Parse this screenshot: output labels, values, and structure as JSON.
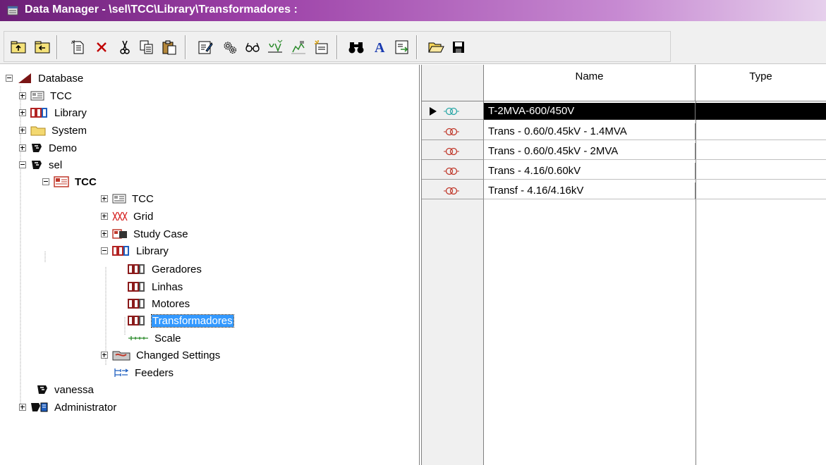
{
  "window": {
    "title": "Data Manager - \\sel\\TCC\\Library\\Transformadores :"
  },
  "toolbar": {
    "buttons": [
      {
        "icon": "folder-up-icon"
      },
      {
        "icon": "folder-back-icon"
      },
      {
        "icon": "new-object-icon"
      },
      {
        "icon": "delete-icon"
      },
      {
        "icon": "cut-icon"
      },
      {
        "icon": "copy-icon"
      },
      {
        "icon": "paste-icon"
      },
      {
        "icon": "edit-object-icon"
      },
      {
        "icon": "settings-gears-icon"
      },
      {
        "icon": "glasses-view-icon"
      },
      {
        "icon": "filter-icon"
      },
      {
        "icon": "graphic-filter-icon"
      },
      {
        "icon": "new-folder-icon"
      },
      {
        "icon": "binoculars-find-icon"
      },
      {
        "icon": "font-icon"
      },
      {
        "icon": "export-icon"
      },
      {
        "icon": "open-icon"
      },
      {
        "icon": "save-icon"
      }
    ]
  },
  "tree": {
    "root": "Database",
    "items": [
      {
        "label": "TCC"
      },
      {
        "label": "Library"
      },
      {
        "label": "System"
      },
      {
        "label": "Demo"
      },
      {
        "label": "sel"
      },
      {
        "label": "TCC"
      },
      {
        "label": "TCC"
      },
      {
        "label": "Grid"
      },
      {
        "label": "Study Case"
      },
      {
        "label": "Library"
      },
      {
        "label": "Geradores"
      },
      {
        "label": "Linhas"
      },
      {
        "label": "Motores"
      },
      {
        "label": "Transformadores"
      },
      {
        "label": "Scale"
      },
      {
        "label": "Changed Settings"
      },
      {
        "label": "Feeders"
      },
      {
        "label": "vanessa"
      },
      {
        "label": "Administrator"
      }
    ]
  },
  "grid": {
    "columns": [
      "Name",
      "Type"
    ],
    "rows": [
      {
        "name": "T-2MVA-600/450V",
        "type": ""
      },
      {
        "name": "Trans - 0.60/0.45kV - 1.4MVA",
        "type": ""
      },
      {
        "name": "Trans - 0.60/0.45kV - 2MVA",
        "type": ""
      },
      {
        "name": "Trans - 4.16/0.60kV",
        "type": ""
      },
      {
        "name": "Transf - 4.16/4.16kV",
        "type": ""
      }
    ]
  },
  "colors": {
    "title_bar": "#7a2a85",
    "selection": "#3399ff",
    "tcc_red": "#c0392b",
    "library_red": "#b22222"
  }
}
